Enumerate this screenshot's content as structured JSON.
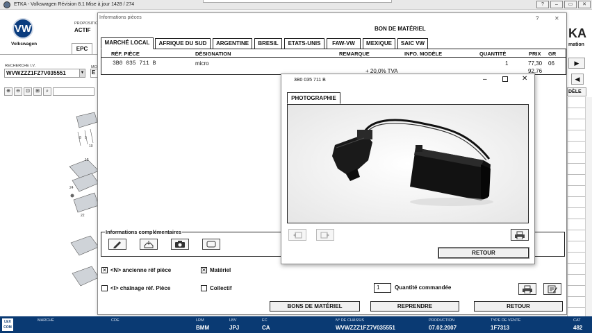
{
  "window": {
    "title": "ETKA - Volkswagen Révision 8.1 Mise à jour 1428 / 274"
  },
  "brand": {
    "name": "Volkswagen",
    "logo_text": "VW"
  },
  "left": {
    "proposition_label": "PROPOSITIO",
    "proposition_value": "ACTIF",
    "mo_label": "MO",
    "mo_value": "E",
    "epc_tab": "EPC",
    "recherche_label": "RECHERCHE I.V.",
    "vin_value": "WVWZZZ1FZ7V035551"
  },
  "right": {
    "partial_logo": "KA",
    "partial_logo_sub": "mation",
    "modele_partial": "DÈLE"
  },
  "dialog": {
    "title": "Informations pièces",
    "help": "?",
    "close": "✕",
    "bon_title": "BON DE MATÉRIEL",
    "tabs": [
      "MARCHÉ LOCAL",
      "AFRIQUE DU SUD",
      "ARGENTINE",
      "BRESIL",
      "ETATS-UNIS",
      "FAW-VW",
      "MEXIQUE",
      "SAIC VW"
    ],
    "columns": {
      "ref": "RÉF. PIÈCE",
      "designation": "DÉSIGNATION",
      "remarque": "REMARQUE",
      "info": "INFO. MODÈLE",
      "quantite": "QUANTITÉ",
      "prix": "PRIX",
      "gr": "GR"
    },
    "row": {
      "ref": "3B0 035 711 B",
      "designation": "micro",
      "remarque": "+ 20,0% TVA",
      "quantite": "1",
      "prix": "77,30",
      "prix_ttc": "92,76",
      "gr": "06"
    },
    "info_comp_label": "Informations complémentaires",
    "options": {
      "ancienne_ref": "<N> ancienne réf pièce",
      "chainage_ref": "<I> chaînage réf. Pièce",
      "materiel": "Matériel",
      "collectif": "Collectif"
    },
    "quantite_value": "1",
    "quantite_label": "Quantité commandée",
    "buttons": {
      "bons": "BONS DE MATÉRIEL",
      "reprendre": "REPRENDRE",
      "retour": "RETOUR"
    }
  },
  "photo": {
    "title": "3B0 035 711 B",
    "tab": "PHOTOGRAPHIE",
    "retour": "RETOUR"
  },
  "status": {
    "marche_label": "MARCHÉ",
    "cde_label": "CDE",
    "lrm_label": "LRM",
    "lrm_value": "BMM",
    "lbv_label": "LBV",
    "lbv_value": "JPJ",
    "ec_label": "EC",
    "ec_value": "CA",
    "chassis_label": "N° DE CHÂSSIS",
    "chassis_value": "WVWZZZ1FZ7V035551",
    "production_label": "PRODUCTION",
    "production_value": "07.02.2007",
    "type_label": "TYPE DE VENTE",
    "type_value": "1F7313",
    "cat_label": "CAT",
    "cat_value": "482",
    "lexcom": "LEX COM"
  },
  "colors": {
    "statusbar": "#0a3a73",
    "vw_blue": "#0a3c7e"
  }
}
